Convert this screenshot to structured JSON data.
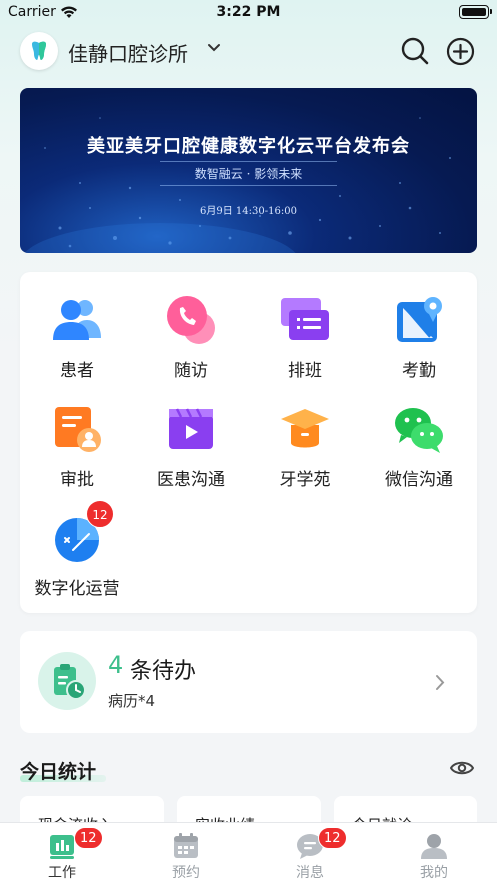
{
  "status_bar": {
    "carrier": "Carrier",
    "time": "3:22 PM"
  },
  "header": {
    "clinic_name": "佳静口腔诊所"
  },
  "banner": {
    "title": "美亚美牙口腔健康数字化云平台发布会",
    "subtitle": "数智融云 · 影领未来",
    "date": "6月9日  14:30-16:00"
  },
  "grid": {
    "items": [
      {
        "label": "患者",
        "icon": "patients-icon"
      },
      {
        "label": "随访",
        "icon": "followup-phone-icon"
      },
      {
        "label": "排班",
        "icon": "schedule-icon"
      },
      {
        "label": "考勤",
        "icon": "attendance-map-icon"
      },
      {
        "label": "审批",
        "icon": "approval-icon"
      },
      {
        "label": "医患沟通",
        "icon": "video-communication-icon"
      },
      {
        "label": "牙学苑",
        "icon": "graduation-cap-icon"
      },
      {
        "label": "微信沟通",
        "icon": "wechat-icon"
      },
      {
        "label": "数字化运营",
        "icon": "digital-operation-icon",
        "badge": "12"
      }
    ]
  },
  "todo": {
    "count": "4",
    "title": "条待办",
    "detail": "病历*4"
  },
  "stats": {
    "title": "今日统计",
    "cards": [
      "现金流收入",
      "实收业绩",
      "今日就诊"
    ]
  },
  "tab_bar": {
    "items": [
      {
        "label": "工作",
        "icon": "work-icon",
        "badge": "12",
        "active": true
      },
      {
        "label": "预约",
        "icon": "calendar-icon"
      },
      {
        "label": "消息",
        "icon": "message-icon",
        "badge": "12"
      },
      {
        "label": "我的",
        "icon": "profile-icon"
      }
    ]
  },
  "colors": {
    "accent": "#3dbf8c",
    "badge": "#ee2d2d",
    "banner_bg": "#061a52"
  }
}
